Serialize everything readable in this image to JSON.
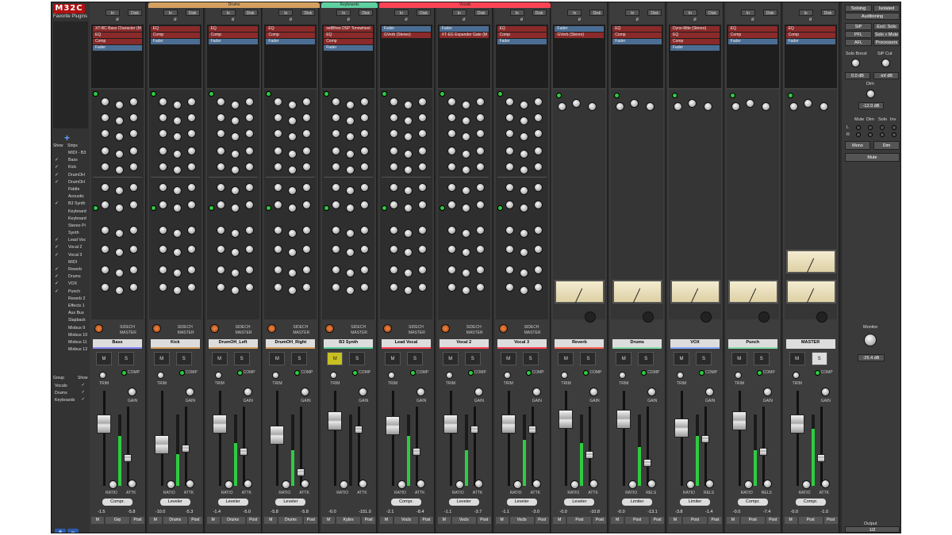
{
  "app": {
    "logo": "M32C",
    "favorites_title": "Favorite Plugins",
    "show_label": "Show",
    "strips_label": "Strips",
    "group_label": "Group",
    "group_show_label": "Show"
  },
  "strip_list": [
    {
      "name": "MIDI - B3",
      "checked": false
    },
    {
      "name": "Bass",
      "checked": true
    },
    {
      "name": "Kick",
      "checked": true
    },
    {
      "name": "DrumOH",
      "checked": true
    },
    {
      "name": "DrumOH",
      "checked": true
    },
    {
      "name": "Fiddle",
      "checked": false
    },
    {
      "name": "Acoustic",
      "checked": false
    },
    {
      "name": "B3 Synth",
      "checked": true
    },
    {
      "name": "Keyboard",
      "checked": false
    },
    {
      "name": "Keyboard",
      "checked": false
    },
    {
      "name": "Stereo Pi",
      "checked": false
    },
    {
      "name": "Synth",
      "checked": false
    },
    {
      "name": "Lead Voc",
      "checked": true
    },
    {
      "name": "Vocal 2",
      "checked": true
    },
    {
      "name": "Vocal 3",
      "checked": true
    },
    {
      "name": "MIDI",
      "checked": false
    },
    {
      "name": "Reverb",
      "checked": true
    },
    {
      "name": "Drums",
      "checked": true
    },
    {
      "name": "VOX",
      "checked": true
    },
    {
      "name": "Punch",
      "checked": true
    },
    {
      "name": "Reverb 2",
      "checked": false
    },
    {
      "name": "Effects 1",
      "checked": false
    },
    {
      "name": "Aux Bus",
      "checked": false
    },
    {
      "name": "Slapback",
      "checked": false
    },
    {
      "name": "Mixbus 9",
      "checked": false
    },
    {
      "name": "Mixbus 10",
      "checked": false
    },
    {
      "name": "Mixbus 11",
      "checked": false
    },
    {
      "name": "Mixbus 12",
      "checked": false
    }
  ],
  "groups": [
    {
      "name": "Vocals",
      "checked": true
    },
    {
      "name": "Drums",
      "checked": true
    },
    {
      "name": "Keyboards",
      "checked": true
    }
  ],
  "group_tabs": [
    {
      "label": "Drums",
      "color": "#d4a060"
    },
    {
      "label": "Keyboards",
      "color": "#5fd0a0"
    },
    {
      "label": "Vocals",
      "color": "#ff4455"
    }
  ],
  "io": {
    "input": "In",
    "disk": "Disk"
  },
  "strips": [
    {
      "name": "Bass",
      "color": "#8888ff",
      "inserts": [
        {
          "t": "XT-BC Bass Character (M",
          "c": "red"
        },
        {
          "t": "EQ",
          "c": "red"
        },
        {
          "t": "Comp",
          "c": "red"
        },
        {
          "t": "Fader",
          "c": "blue"
        }
      ],
      "gain": "-1.5",
      "peak": "-5.8",
      "group": "Grp",
      "type": "Compr."
    },
    {
      "name": "Kick",
      "color": "#d4a060",
      "inserts": [
        {
          "t": "EQ",
          "c": "red"
        },
        {
          "t": "Comp",
          "c": "red"
        },
        {
          "t": "Fader",
          "c": "blue"
        }
      ],
      "gain": "-10.0",
      "peak": "-5.3",
      "group": "Drums",
      "type": "Leveler"
    },
    {
      "name": "DrumOH_Left",
      "color": "#d4a060",
      "inserts": [
        {
          "t": "EQ",
          "c": "red"
        },
        {
          "t": "Comp",
          "c": "red"
        },
        {
          "t": "Fader",
          "c": "blue"
        }
      ],
      "gain": "-1.4",
      "peak": "-5.0",
      "group": "Drums",
      "type": "Leveler"
    },
    {
      "name": "DrumOH_Right",
      "color": "#d4a060",
      "inserts": [
        {
          "t": "EQ",
          "c": "red"
        },
        {
          "t": "Comp",
          "c": "red"
        },
        {
          "t": "Fader",
          "c": "blue"
        }
      ],
      "gain": "-5.8",
      "peak": "-5.8",
      "group": "Drums",
      "type": "Leveler"
    },
    {
      "name": "B3 Synth",
      "color": "#5fd0a0",
      "inserts": [
        {
          "t": "setBfree DSP Tonewheel",
          "c": "red"
        },
        {
          "t": "EQ",
          "c": "red"
        },
        {
          "t": "Comp",
          "c": "red"
        },
        {
          "t": "Fader",
          "c": "blue"
        }
      ],
      "gain": "-0.0",
      "peak": "-151.0",
      "group": "Kybrs",
      "type": ""
    },
    {
      "name": "Lead Vocal",
      "color": "#ff4455",
      "inserts": [
        {
          "t": "Fader",
          "c": "blue"
        },
        {
          "t": "GVerb (Stereo)",
          "c": "red"
        }
      ],
      "gain": "-2.1",
      "peak": "-8.4",
      "group": "Vocls",
      "type": "Compr."
    },
    {
      "name": "Vocal 2",
      "color": "#ff4455",
      "inserts": [
        {
          "t": "Fader",
          "c": "blue"
        },
        {
          "t": "XT-EG Expander Gate (M",
          "c": "red"
        }
      ],
      "gain": "-1.1",
      "peak": "-3.7",
      "group": "Vocls",
      "type": "Leveler"
    },
    {
      "name": "Vocal 3",
      "color": "#ff4455",
      "inserts": [
        {
          "t": "EQ",
          "c": "red"
        },
        {
          "t": "Comp",
          "c": "red"
        },
        {
          "t": "Fader",
          "c": "blue"
        }
      ],
      "gain": "-1.1",
      "peak": "-3.0",
      "group": "Vocls",
      "type": "Leveler"
    },
    {
      "name": "Reverb",
      "color": "#ff6655",
      "inserts": [
        {
          "t": "Fader",
          "c": "blue"
        },
        {
          "t": "GVerb (Stereo)",
          "c": "red"
        }
      ],
      "gain": "-0.0",
      "peak": "-10.8",
      "group": "Post",
      "type": "Leveler"
    },
    {
      "name": "Drums",
      "color": "#88ddaa",
      "inserts": [
        {
          "t": "EQ",
          "c": "red"
        },
        {
          "t": "Comp",
          "c": "red"
        },
        {
          "t": "Fader",
          "c": "blue"
        }
      ],
      "gain": "-0.0",
      "peak": "-13.1",
      "group": "Post",
      "type": "Limiter"
    },
    {
      "name": "VOX",
      "color": "#88aaff",
      "inserts": [
        {
          "t": "Dyno-Mite (Stereo)",
          "c": "red"
        },
        {
          "t": "EQ",
          "c": "red"
        },
        {
          "t": "Comp",
          "c": "red"
        },
        {
          "t": "Fader",
          "c": "blue"
        }
      ],
      "gain": "-3.8",
      "peak": "-1.4",
      "group": "Post",
      "type": "Limiter"
    },
    {
      "name": "Punch",
      "color": "#88ddaa",
      "inserts": [
        {
          "t": "EQ",
          "c": "red"
        },
        {
          "t": "Comp",
          "c": "red"
        },
        {
          "t": "Fader",
          "c": "blue"
        }
      ],
      "gain": "-0.0",
      "peak": "-7.4",
      "group": "Post",
      "type": "Compr."
    },
    {
      "name": "MASTER",
      "color": "#dddddd",
      "inserts": [
        {
          "t": "EQ",
          "c": "red"
        },
        {
          "t": "Comp",
          "c": "red"
        },
        {
          "t": "Fader",
          "c": "blue"
        }
      ],
      "gain": "-0.0",
      "peak": "-1.0",
      "group": "Post",
      "type": "Compr."
    }
  ],
  "labels": {
    "mute": "M",
    "solo": "S",
    "trim": "TRIM",
    "comp": "COMP",
    "gain": "GAIN",
    "attk": "ATTK",
    "ratio": "RATIO",
    "rels": "RELS",
    "sidech": "SIDECH",
    "master_to": "MASTER",
    "monitor": "Monitor"
  },
  "monitor": {
    "soloing": "Soloing",
    "isolated": "Isolated",
    "auditioning": "Auditioning",
    "sip": "SiP",
    "excl_solo": "Excl. Solo",
    "pfl": "PFL",
    "solo_mute": "Solo » Mute",
    "afl": "AFL",
    "processors": "Processors",
    "solo_boost": "Solo Boost",
    "sip_cut": "SiP Cut",
    "solo_boost_val": "0.0 dB",
    "sip_cut_val": "-inf dB",
    "dim": "Dim",
    "dim_val": "-12.0 dB",
    "cols": [
      "Mute",
      "Dim",
      "Solo",
      "Inv"
    ],
    "rows": [
      "L",
      "R"
    ],
    "mono": "Mono",
    "dim_btn": "Dim",
    "mute": "Mute",
    "monitor": "Monitor",
    "monitor_val": "-25.4 dB",
    "output": "Output",
    "output_val": "1/2"
  }
}
